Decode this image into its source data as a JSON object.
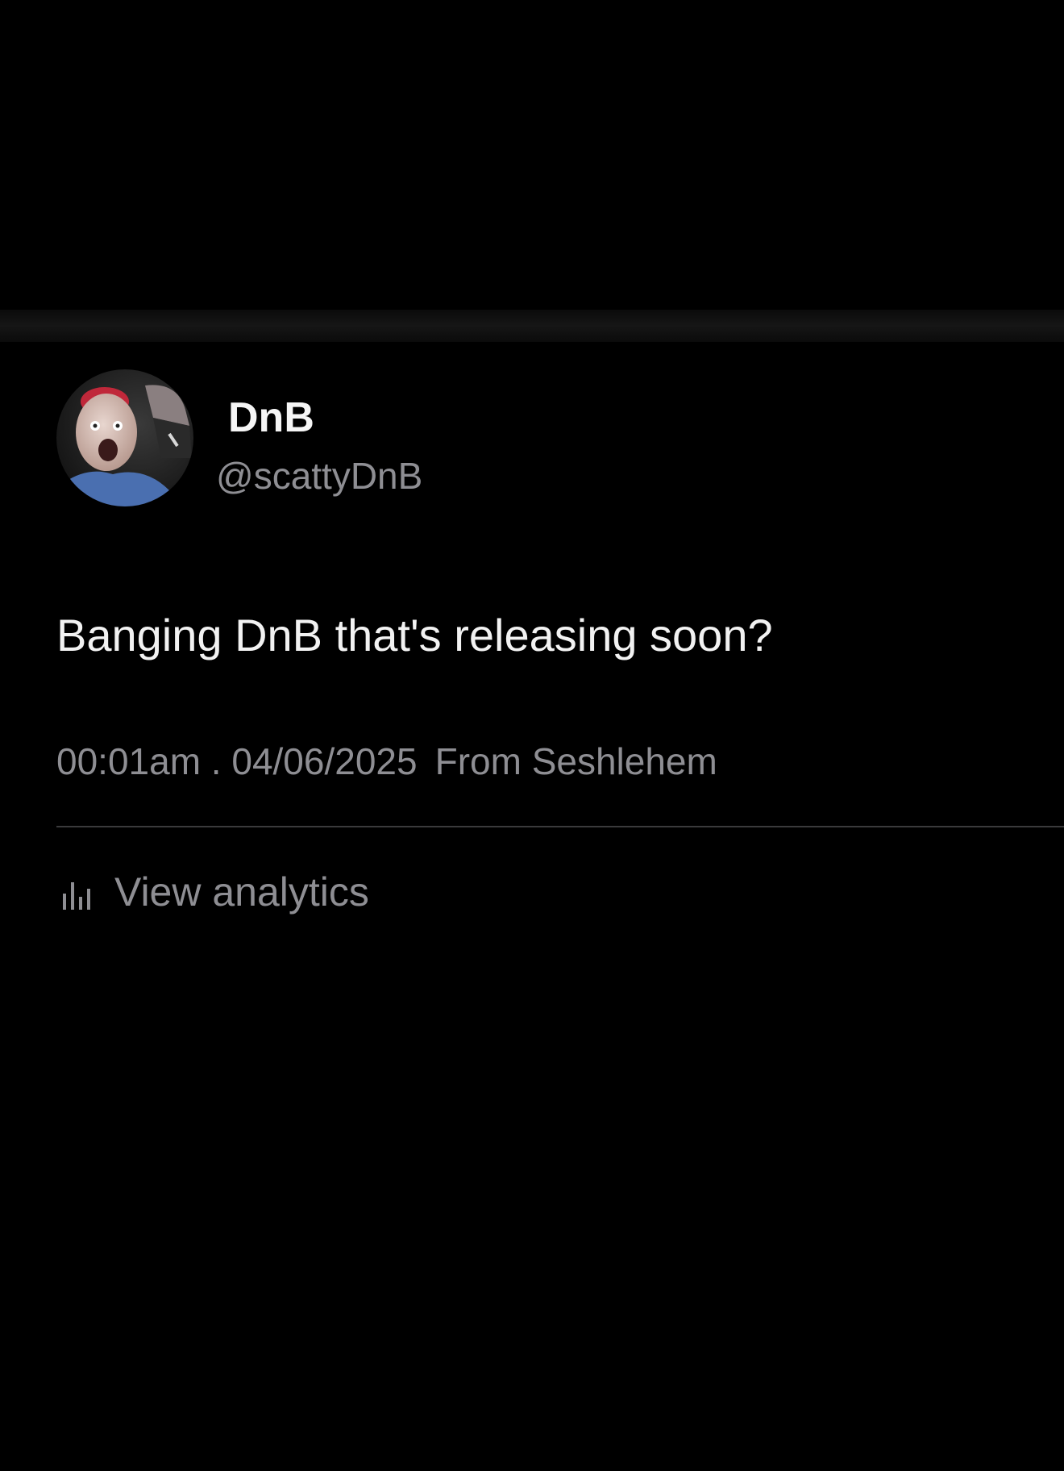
{
  "post": {
    "author": {
      "display_name": "DnB",
      "handle": "@scattyDnB",
      "avatar_icon": "profile-photo"
    },
    "text": "Banging DnB that's releasing soon?",
    "meta": {
      "timestamp": "00:01am . 04/06/2025",
      "source": "From Seshlehem"
    },
    "actions": {
      "analytics_label": "View analytics",
      "analytics_icon": "bar-chart-icon"
    }
  },
  "colors": {
    "background": "#000000",
    "primary_text": "#f2f2f2",
    "secondary_text": "#8e8e93",
    "divider": "#3a3a3c"
  }
}
